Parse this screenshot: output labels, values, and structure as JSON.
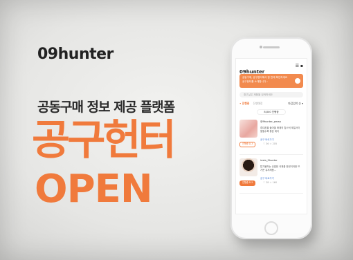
{
  "brand": {
    "logo": "09hunter",
    "accent": "#f07a3c"
  },
  "hero": {
    "subtitle": "공동구매 정보 제공 플랫폼",
    "headline": "공구헌터",
    "open": "OPEN"
  },
  "phone": {
    "app_logo": "09hunter",
    "header_icons": "☰ ▪",
    "banner": {
      "text": "공동구매, 공구헌터에서 한 번에 확인하세요",
      "cta": "공구헌터를 소개합니다 ›"
    },
    "search_placeholder": "찾고싶은 제품을 검색하세요",
    "tabs": {
      "active": "• 진행중",
      "inactive": "진행예정",
      "sort": "마감임박 순 ▾"
    },
    "count_badge": "8,840 진행중",
    "cards": [
      {
        "user": "@9hunter_pmaa",
        "desc": "휴대폰을 들어올 화제의 립스틱 제일사이 얼릴수록 좋은 제이",
        "link": "공구 바로가기",
        "tag": "진행중 D-3",
        "meta": "♡ 36   ☆ 205"
      },
      {
        "user": "insta_9hunter",
        "desc": "탑가볼하는 신발한 국제품 한번이러한 뜨거운 유저제품...",
        "link": "공구 바로가기",
        "tag": "진행중 D-5",
        "meta": "♡ 28   ☆ 160"
      }
    ]
  }
}
